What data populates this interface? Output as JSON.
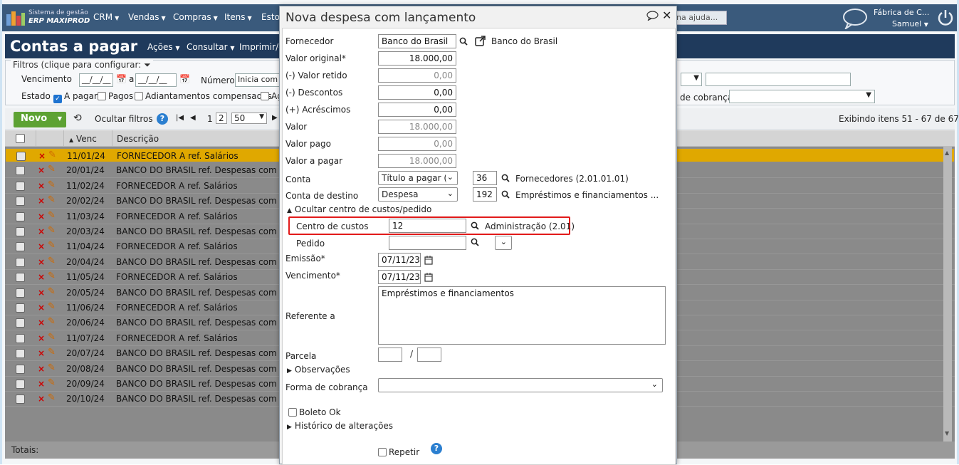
{
  "topbar": {
    "brand_line1": "Sistema de gestão",
    "brand_line2": "ERP MAXIPROD",
    "menu": [
      "CRM",
      "Vendas",
      "Compras",
      "Itens",
      "Estoque"
    ],
    "help_text": "na ajuda...",
    "company": "Fábrica de C...",
    "user": "Samuel"
  },
  "page": {
    "title": "Contas a pagar",
    "actions": [
      "Ações",
      "Consultar",
      "Imprimir/exportar"
    ]
  },
  "filters": {
    "legend": "Filtros (clique para configurar:",
    "vencimento_label": "Vencimento",
    "date_placeholder": "__/__/__",
    "a_label": "a",
    "numero_label": "Número",
    "numero_value": "Inicia com",
    "estado_label": "Estado",
    "estado_options": [
      {
        "label": "A pagar",
        "checked": true
      },
      {
        "label": "Pagos",
        "checked": false
      },
      {
        "label": "Adiantamentos compensados",
        "checked": false
      },
      {
        "label": "Ag",
        "checked": false
      }
    ],
    "forma_cobranca_label": "de cobrança"
  },
  "toolbar": {
    "novo": "Novo",
    "ocultar_filtros": "Ocultar filtros",
    "pages": [
      "1",
      "2"
    ],
    "page_size": "50",
    "exibindo": "Exibindo itens 51 - 67 de 67"
  },
  "grid": {
    "columns": [
      "Venc",
      "Descrição"
    ],
    "rows": [
      {
        "venc": "11/01/24",
        "desc": "FORNECEDOR A ref. Salários",
        "selected": true
      },
      {
        "venc": "20/01/24",
        "desc": "BANCO DO BRASIL ref. Despesas com águ"
      },
      {
        "venc": "11/02/24",
        "desc": "FORNECEDOR A ref. Salários"
      },
      {
        "venc": "20/02/24",
        "desc": "BANCO DO BRASIL ref. Despesas com águ"
      },
      {
        "venc": "11/03/24",
        "desc": "FORNECEDOR A ref. Salários"
      },
      {
        "venc": "20/03/24",
        "desc": "BANCO DO BRASIL ref. Despesas com águ"
      },
      {
        "venc": "11/04/24",
        "desc": "FORNECEDOR A ref. Salários"
      },
      {
        "venc": "20/04/24",
        "desc": "BANCO DO BRASIL ref. Despesas com águ"
      },
      {
        "venc": "11/05/24",
        "desc": "FORNECEDOR A ref. Salários"
      },
      {
        "venc": "20/05/24",
        "desc": "BANCO DO BRASIL ref. Despesas com águ"
      },
      {
        "venc": "11/06/24",
        "desc": "FORNECEDOR A ref. Salários"
      },
      {
        "venc": "20/06/24",
        "desc": "BANCO DO BRASIL ref. Despesas com águ"
      },
      {
        "venc": "11/07/24",
        "desc": "FORNECEDOR A ref. Salários"
      },
      {
        "venc": "20/07/24",
        "desc": "BANCO DO BRASIL ref. Despesas com águ"
      },
      {
        "venc": "20/08/24",
        "desc": "BANCO DO BRASIL ref. Despesas com águ"
      },
      {
        "venc": "20/09/24",
        "desc": "BANCO DO BRASIL ref. Despesas com águ"
      },
      {
        "venc": "20/10/24",
        "desc": "BANCO DO BRASIL ref. Despesas com águ"
      }
    ],
    "totais": "Totais:"
  },
  "modal": {
    "title": "Nova despesa com lançamento",
    "fornecedor_label": "Fornecedor",
    "fornecedor_value": "Banco do Brasil",
    "fornecedor_link": "Banco do Brasil",
    "valor_original_label": "Valor original*",
    "valor_original": "18.000,00",
    "valor_retido_label": "(-) Valor retido",
    "valor_retido": "0,00",
    "descontos_label": "(-) Descontos",
    "descontos": "0,00",
    "acrescimos_label": "(+) Acréscimos",
    "acrescimos": "0,00",
    "valor_label": "Valor",
    "valor": "18.000,00",
    "valor_pago_label": "Valor pago",
    "valor_pago": "0,00",
    "valor_a_pagar_label": "Valor a pagar",
    "valor_a_pagar": "18.000,00",
    "conta_label": "Conta",
    "conta_select": "Título a pagar (F",
    "conta_code": "36",
    "conta_desc": "Fornecedores (2.01.01.01)",
    "conta_destino_label": "Conta de destino",
    "conta_destino_select": "Despesa",
    "conta_destino_code": "192",
    "conta_destino_desc": "Empréstimos e financiamentos ...",
    "ocultar_centro": "Ocultar centro de custos/pedido",
    "centro_label": "Centro de custos",
    "centro_value": "12",
    "centro_desc": "Administração (2.01)",
    "pedido_label": "Pedido",
    "emissao_label": "Emissão*",
    "emissao": "07/11/23",
    "vencimento_label": "Vencimento*",
    "vencimento": "07/11/23",
    "referente_label": "Referente a",
    "referente": "Empréstimos e financiamentos",
    "parcela_label": "Parcela",
    "parcela_sep": "/",
    "observacoes": "Observações",
    "forma_cobranca_label": "Forma de cobrança",
    "boleto_label": "Boleto Ok",
    "historico": "Histórico de alterações",
    "repetir_label": "Repetir"
  },
  "colors": {
    "topbar": "#3a5a7c",
    "title_bar": "#1f3a5c",
    "novo_button": "#5da233",
    "selected_row": "#e0a800",
    "highlight": "#e21a1a"
  }
}
